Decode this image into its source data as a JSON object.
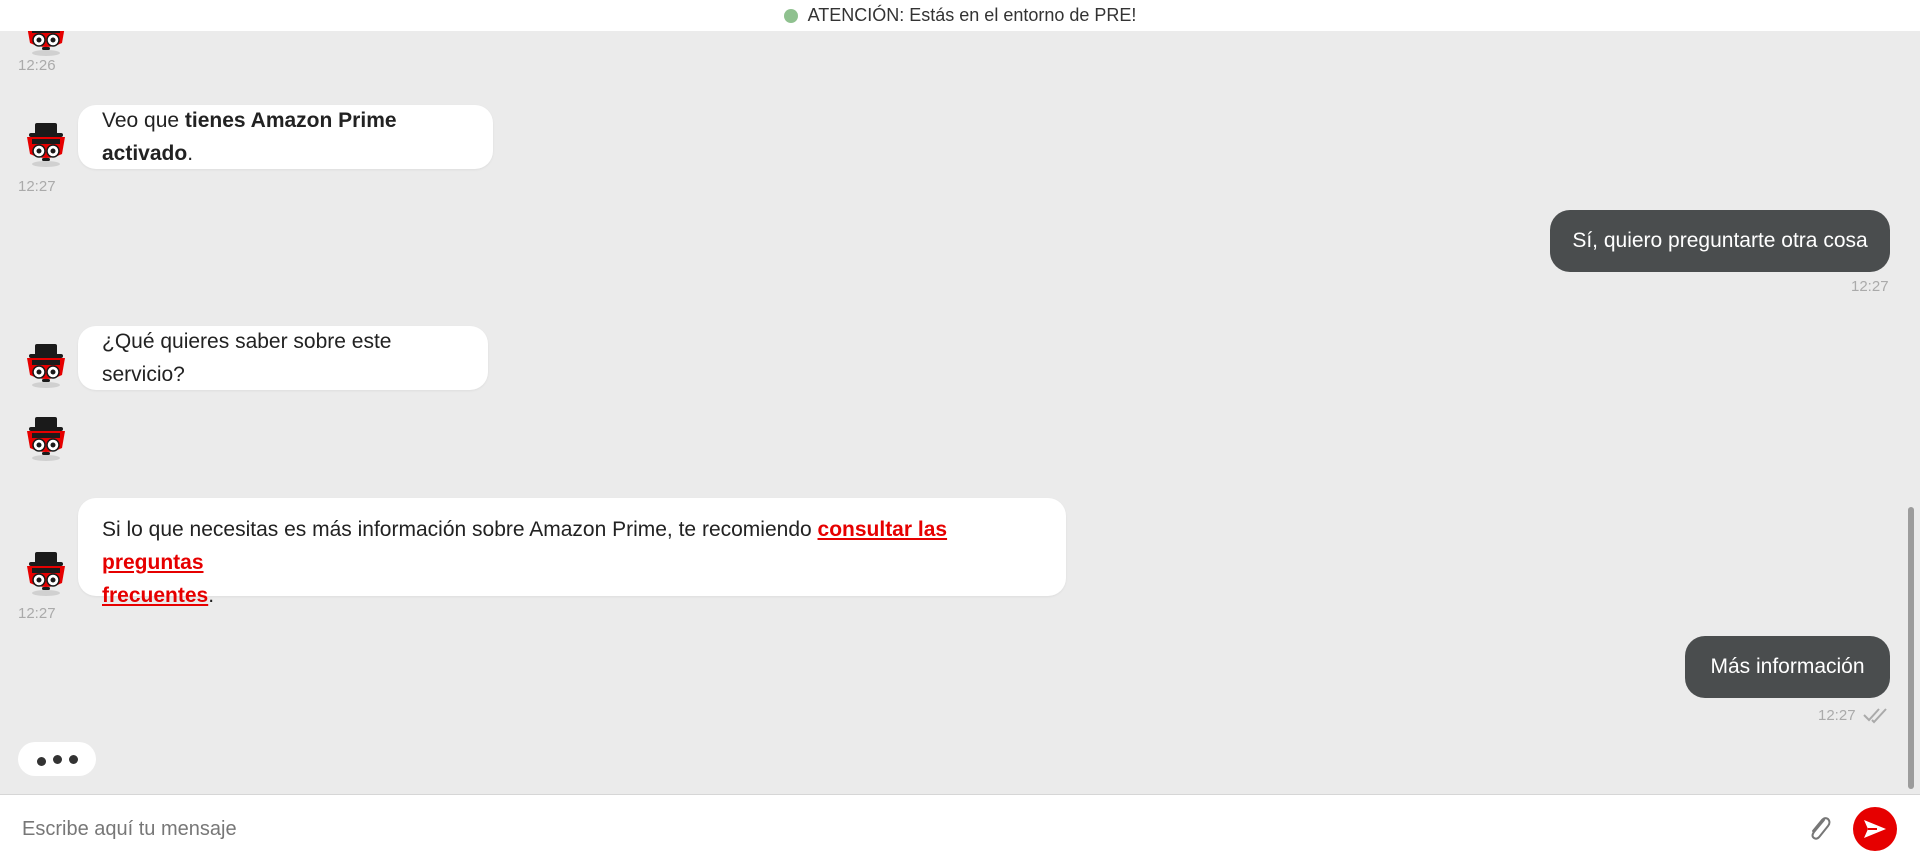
{
  "banner": {
    "text": "ATENCIÓN: Estás en el entorno de PRE!",
    "status_color": "#8fc18f"
  },
  "messages": [
    {
      "from": "bot",
      "time": "12:26"
    },
    {
      "from": "bot",
      "text_before": "Veo que ",
      "text_bold": "tienes Amazon Prime activado",
      "text_after": ".",
      "time": "12:27"
    },
    {
      "from": "user",
      "text": "Sí, quiero preguntarte otra cosa",
      "time": "12:27"
    },
    {
      "from": "bot",
      "text": "¿Qué quieres saber sobre este servicio?"
    },
    {
      "from": "bot",
      "text_before": "Si lo que necesitas es más información sobre Amazon Prime, te recomiendo ",
      "link_line1": "consultar las preguntas ",
      "link_line2": "frecuentes",
      "text_after": ".",
      "time": "12:27"
    },
    {
      "from": "user",
      "text": "Más información",
      "time": "12:27",
      "status_icon": "double-check-icon"
    }
  ],
  "composer": {
    "placeholder": "Escribe aquí tu mensaje",
    "attach_icon": "paperclip-icon",
    "send_icon": "send-icon"
  },
  "colors": {
    "accent": "#e60000",
    "user_bubble": "#4a4d4e",
    "bot_bubble": "#ffffff",
    "background": "#ebebeb"
  }
}
